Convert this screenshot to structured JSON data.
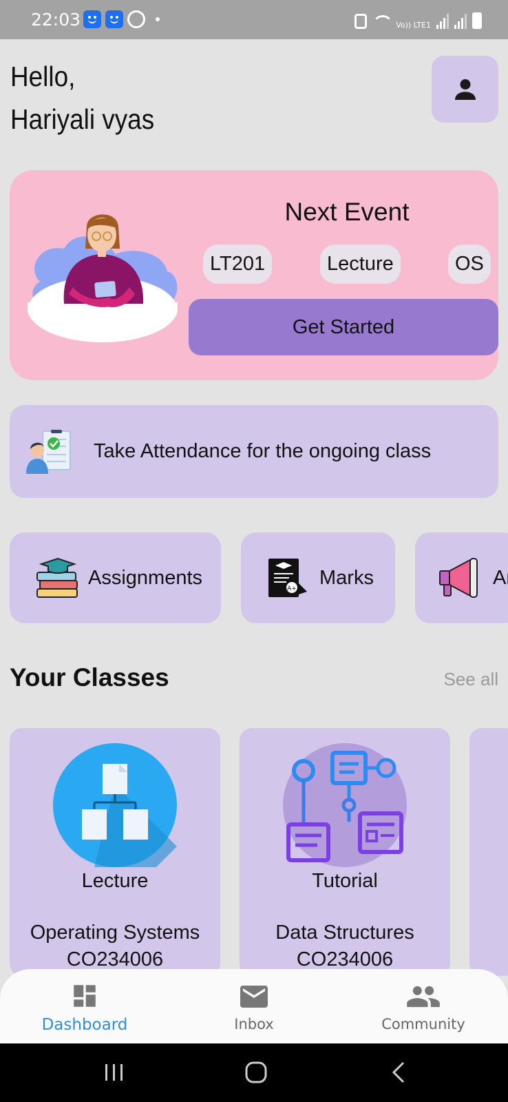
{
  "status_bar": {
    "time": "22:03",
    "network": "Vo)) LTE1"
  },
  "header": {
    "greeting": "Hello,",
    "user_name": "Hariyali vyas",
    "profile_icon": "person-icon"
  },
  "next_event": {
    "title": "Next Event",
    "chips": [
      "LT201",
      "Lecture",
      "OS"
    ],
    "button_label": "Get Started"
  },
  "attendance": {
    "label": "Take Attendance for the ongoing class"
  },
  "quick_actions": [
    {
      "label": "Assignments",
      "icon": "books-graduation-icon"
    },
    {
      "label": "Marks",
      "icon": "report-card-icon"
    },
    {
      "label": "An",
      "icon": "megaphone-icon"
    }
  ],
  "classes_section": {
    "title": "Your Classes",
    "see_all": "See all"
  },
  "classes": [
    {
      "type": "Lecture",
      "name": "Operating Systems",
      "code": "CO234006",
      "icon": "hierarchy-icon",
      "color": "#2aa8f2"
    },
    {
      "type": "Tutorial",
      "name": "Data Structures",
      "code": "CO234006",
      "icon": "workflow-icon",
      "color": "#b39ddb"
    }
  ],
  "bottom_nav": [
    {
      "label": "Dashboard",
      "icon": "dashboard-icon",
      "active": true
    },
    {
      "label": "Inbox",
      "icon": "mail-icon",
      "active": false
    },
    {
      "label": "Community",
      "icon": "people-icon",
      "active": false
    }
  ],
  "colors": {
    "accent": "#9779cf",
    "card": "#d2c6ea",
    "event_bg": "#f8bbd0",
    "active_nav": "#2f8ed6"
  }
}
